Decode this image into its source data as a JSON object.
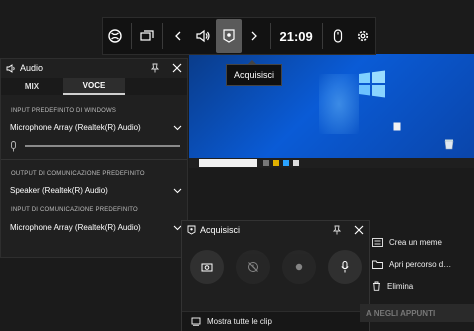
{
  "gamebar": {
    "clock": "21:09",
    "capture_tooltip": "Acquisisci"
  },
  "audio": {
    "title": "Audio",
    "tabs": [
      "MIX",
      "VOCE"
    ],
    "active_tab": "VOCE",
    "sections": [
      {
        "label": "INPUT PREDEFINITO DI WINDOWS",
        "value": "Microphone Array (Realtek(R) Audio)"
      },
      {
        "label": "OUTPUT DI COMUNICAZIONE PREDEFINITO",
        "value": "Speaker (Realtek(R) Audio)"
      },
      {
        "label": "INPUT DI COMUNICAZIONE PREDEFINITO",
        "value": "Microphone Array (Realtek(R) Audio)"
      }
    ]
  },
  "capture": {
    "title": "Acquisisci",
    "footer": "Mostra tutte le clip"
  },
  "side": {
    "items": [
      "Crea un meme",
      "Apri percorso d…",
      "Elimina"
    ],
    "banner": "A NEGLI APPUNTI"
  },
  "colors": {
    "panel": "#202020",
    "desktop_blue": "#0a5bd6",
    "accent_active_tab": "#cfcfcf"
  }
}
